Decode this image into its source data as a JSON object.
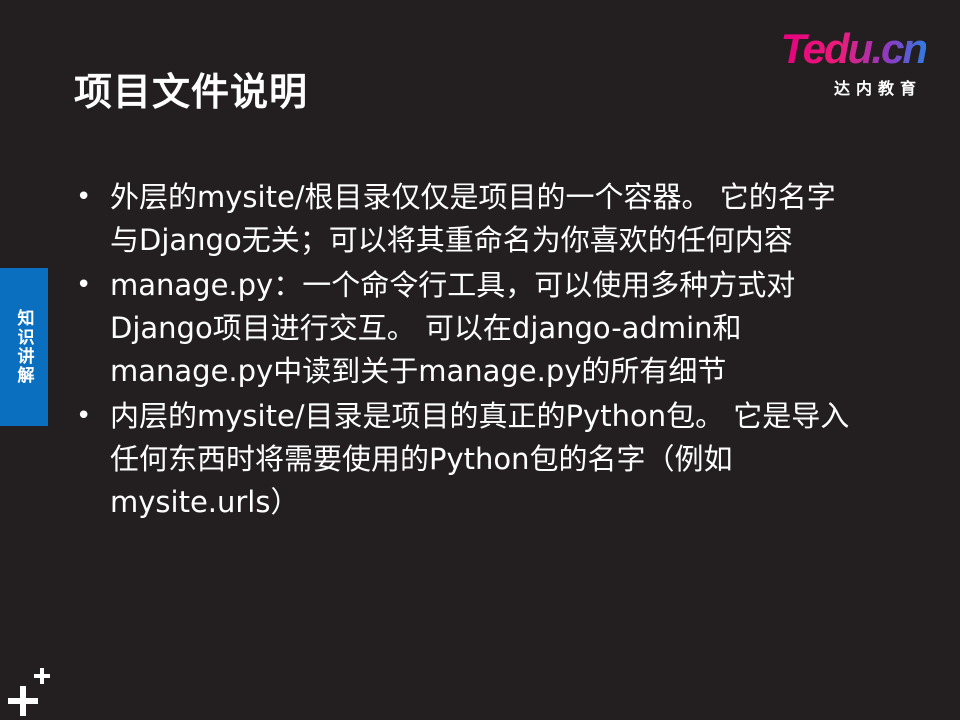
{
  "slide": {
    "title": "项目文件说明"
  },
  "logo": {
    "brand": "Tedu.cn",
    "subtitle": "达内教育"
  },
  "side_tab": {
    "label": "知识讲解"
  },
  "bullets": [
    {
      "text": "外层的mysite/根目录仅仅是项目的一个容器。 它的名字与Django无关；可以将其重命名为你喜欢的任何内容"
    },
    {
      "text": "manage.py：一个命令行工具，可以使用多种方式对Django项目进行交互。 可以在django-admin和manage.py中读到关于manage.py的所有细节"
    },
    {
      "text": "内层的mysite/目录是项目的真正的Python包。 它是导入任何东西时将需要使用的Python包的名字（例如 mysite.urls）"
    }
  ],
  "bullet_glyph": "•",
  "colors": {
    "background": "#231f20",
    "side_tab": "#0b6fbf",
    "logo_pink": "#e4007f",
    "logo_blue": "#2f7de1"
  },
  "icons": {
    "corner": "plus-decoration-icon"
  }
}
